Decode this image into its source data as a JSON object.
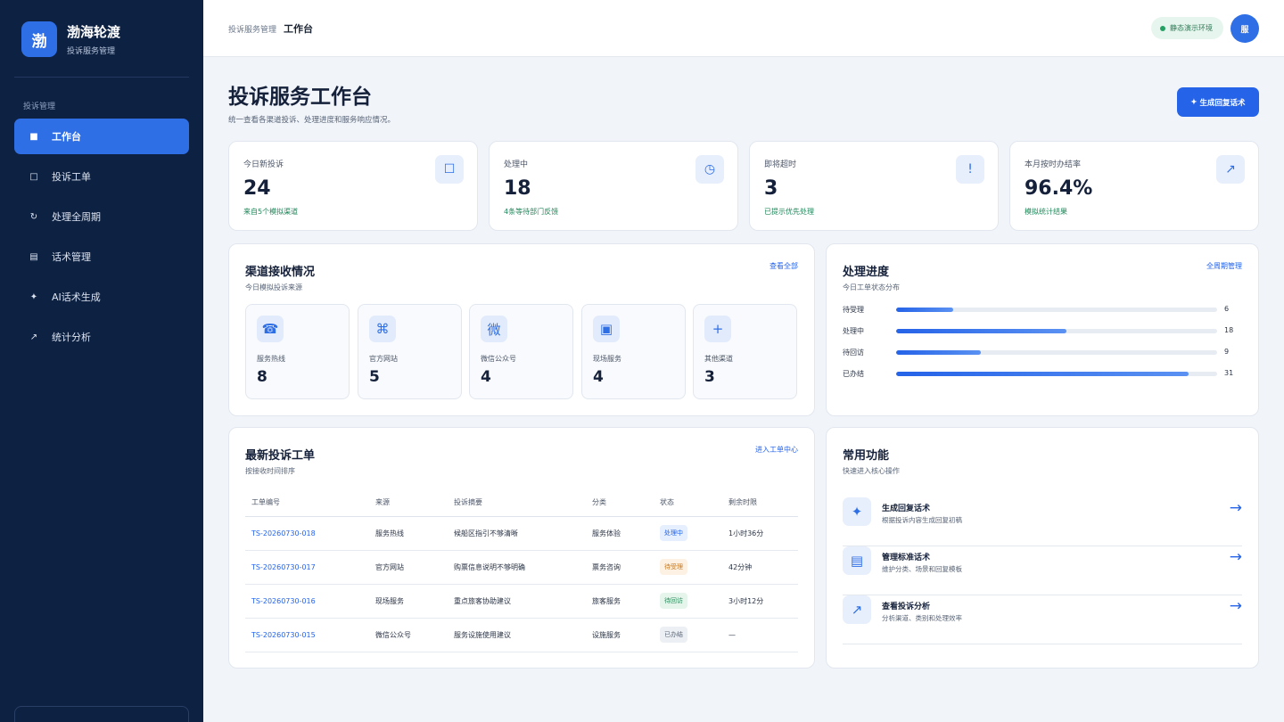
{
  "sidebar": {
    "brand_logo": "渤",
    "brand_name": "渤海轮渡",
    "brand_sub": "投诉服务管理",
    "section_label": "投诉管理",
    "items": [
      {
        "label": "工作台",
        "icon": "dashboard-icon",
        "glyph": "■",
        "active": true
      },
      {
        "label": "投诉工单",
        "icon": "ticket-icon",
        "glyph": "□",
        "active": false
      },
      {
        "label": "处理全周期",
        "icon": "cycle-icon",
        "glyph": "↻",
        "active": false
      },
      {
        "label": "话术管理",
        "icon": "script-icon",
        "glyph": "▤",
        "active": false
      },
      {
        "label": "AI话术生成",
        "icon": "sparkle-icon",
        "glyph": "✦",
        "active": false
      },
      {
        "label": "统计分析",
        "icon": "trend-icon",
        "glyph": "↗",
        "active": false
      }
    ]
  },
  "topbar": {
    "breadcrumb_parent": "投诉服务管理",
    "breadcrumb_current": "工作台",
    "env_badge": "静态演示环境",
    "avatar": "服"
  },
  "header": {
    "title": "投诉服务工作台",
    "subtitle": "统一查看各渠道投诉、处理进度和服务响应情况。",
    "generate_button": "生成回复话术",
    "generate_glyph": "✦"
  },
  "stats": [
    {
      "label": "今日新投诉",
      "value": "24",
      "note": "来自5个模拟渠道",
      "icon": "inbox-icon",
      "glyph": "☐"
    },
    {
      "label": "处理中",
      "value": "18",
      "note": "4条等待部门反馈",
      "icon": "clock-icon",
      "glyph": "◷"
    },
    {
      "label": "即将超时",
      "value": "3",
      "note": "已提示优先处理",
      "icon": "alert-icon",
      "glyph": "!"
    },
    {
      "label": "本月按时办结率",
      "value": "96.4%",
      "note": "模拟统计结果",
      "icon": "trend-icon",
      "glyph": "↗"
    }
  ],
  "channels": {
    "title": "渠道接收情况",
    "subtitle": "今日模拟投诉来源",
    "link": "查看全部",
    "items": [
      {
        "name": "服务热线",
        "count": "8",
        "icon": "phone-icon",
        "glyph": "☎"
      },
      {
        "name": "官方网站",
        "count": "5",
        "icon": "website-icon",
        "glyph": "⌘"
      },
      {
        "name": "微信公众号",
        "count": "4",
        "icon": "wechat-icon",
        "glyph": "微"
      },
      {
        "name": "现场服务",
        "count": "4",
        "icon": "onsite-icon",
        "glyph": "▣"
      },
      {
        "name": "其他渠道",
        "count": "3",
        "icon": "plus-icon",
        "glyph": "+"
      }
    ]
  },
  "progress": {
    "title": "处理进度",
    "subtitle": "今日工单状态分布",
    "link": "全周期管理",
    "max": 34,
    "items": [
      {
        "label": "待受理",
        "value": 6
      },
      {
        "label": "处理中",
        "value": 18
      },
      {
        "label": "待回访",
        "value": 9
      },
      {
        "label": "已办结",
        "value": 31
      }
    ]
  },
  "tickets": {
    "title": "最新投诉工单",
    "subtitle": "按接收时间排序",
    "link": "进入工单中心",
    "columns": [
      "工单编号",
      "来源",
      "投诉摘要",
      "分类",
      "状态",
      "剩余时限"
    ],
    "rows": [
      {
        "id": "TS-20260730-018",
        "source": "服务热线",
        "summary": "候船区指引不够清晰",
        "category": "服务体验",
        "status": "处理中",
        "status_bg": "#e6effd",
        "status_fg": "#2563e8",
        "remaining": "1小时36分"
      },
      {
        "id": "TS-20260730-017",
        "source": "官方网站",
        "summary": "购票信息说明不够明确",
        "category": "票务咨询",
        "status": "待受理",
        "status_bg": "#fdf1e3",
        "status_fg": "#c8791e",
        "remaining": "42分钟"
      },
      {
        "id": "TS-20260730-016",
        "source": "现场服务",
        "summary": "重点旅客协助建议",
        "category": "旅客服务",
        "status": "待回访",
        "status_bg": "#e6f5ec",
        "status_fg": "#2b8a5a",
        "remaining": "3小时12分"
      },
      {
        "id": "TS-20260730-015",
        "source": "微信公众号",
        "summary": "服务设施使用建议",
        "category": "设施服务",
        "status": "已办结",
        "status_bg": "#eceff3",
        "status_fg": "#5d6878",
        "remaining": "—"
      }
    ]
  },
  "quick": {
    "title": "常用功能",
    "subtitle": "快速进入核心操作",
    "arrow": "→",
    "items": [
      {
        "title": "生成回复话术",
        "desc": "根据投诉内容生成回复初稿",
        "icon": "sparkle-icon",
        "glyph": "✦"
      },
      {
        "title": "管理标准话术",
        "desc": "维护分类、场景和回复模板",
        "icon": "document-icon",
        "glyph": "▤"
      },
      {
        "title": "查看投诉分析",
        "desc": "分析渠道、类别和处理效率",
        "icon": "trend-icon",
        "glyph": "↗"
      }
    ]
  }
}
